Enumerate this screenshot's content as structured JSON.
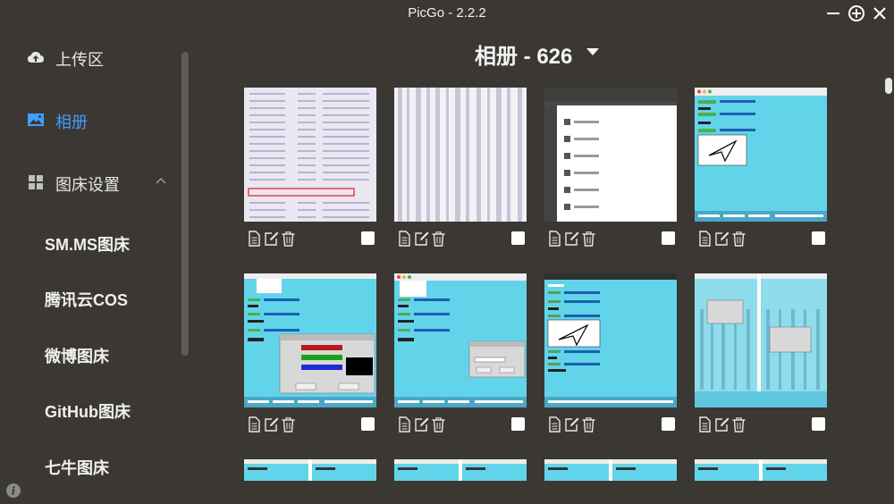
{
  "window": {
    "title": "PicGo - 2.2.2"
  },
  "sidebar": {
    "items": [
      {
        "label": "上传区",
        "icon": "cloud-upload-icon"
      },
      {
        "label": "相册",
        "icon": "image-icon",
        "active": true
      },
      {
        "label": "图床设置",
        "icon": "grid-icon"
      }
    ],
    "subitems": [
      {
        "label": "SM.MS图床"
      },
      {
        "label": "腾讯云COS"
      },
      {
        "label": "微博图床"
      },
      {
        "label": "GitHub图床"
      },
      {
        "label": "七牛图床"
      }
    ]
  },
  "gallery": {
    "title": "相册 - 626",
    "images": [
      {
        "kind": "text-shot"
      },
      {
        "kind": "blur-shot"
      },
      {
        "kind": "file-list-shot"
      },
      {
        "kind": "chat-shot-a"
      },
      {
        "kind": "chat-color-dialog"
      },
      {
        "kind": "chat-input-dialog"
      },
      {
        "kind": "chat-shot-b"
      },
      {
        "kind": "two-panel-shot"
      },
      {
        "kind": "strip"
      },
      {
        "kind": "strip"
      },
      {
        "kind": "strip"
      },
      {
        "kind": "strip"
      }
    ]
  },
  "colors": {
    "accent": "#409eff",
    "background": "#3b3834",
    "thumb_cyan": "#62d4ea"
  }
}
